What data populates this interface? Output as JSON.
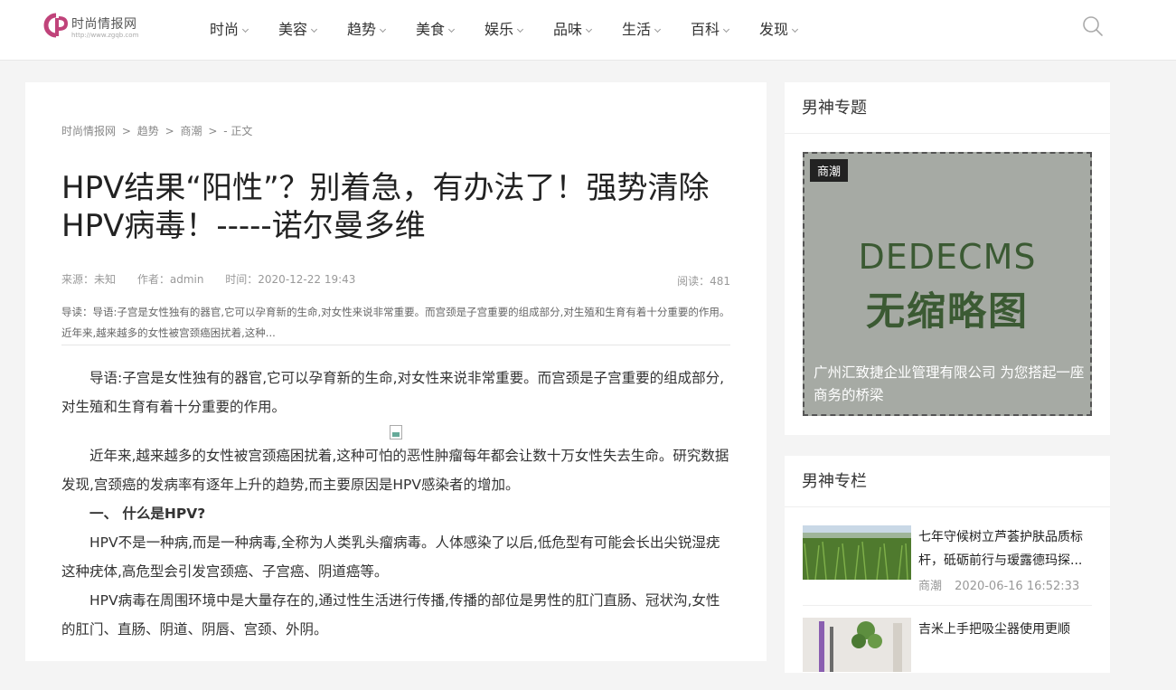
{
  "logo": {
    "name": "时尚情报网",
    "url": "http://www.zgqb.com"
  },
  "nav": [
    {
      "label": "时尚"
    },
    {
      "label": "美容"
    },
    {
      "label": "趋势"
    },
    {
      "label": "美食"
    },
    {
      "label": "娱乐"
    },
    {
      "label": "品味"
    },
    {
      "label": "生活"
    },
    {
      "label": "百科"
    },
    {
      "label": "发现"
    }
  ],
  "breadcrumb": {
    "home": "时尚情报网",
    "sep1": ">",
    "cat": "趋势",
    "sep2": ">",
    "sub": "商潮",
    "sep3": ">",
    "tail": "-  正文"
  },
  "article": {
    "title": "HPV结果“阳性”？别着急，有办法了！强势清除HPV病毒！-----诺尔曼多维",
    "source": "来源：未知",
    "author": "作者：admin",
    "time": "时间：2020-12-22 19:43",
    "reads": "阅读：481",
    "summary": "导读：导语:子宫是女性独有的器官,它可以孕育新的生命,对女性来说非常重要。而宫颈是子宫重要的组成部分,对生殖和生育有着十分重要的作用。 近年来,越来越多的女性被宫颈癌困扰着,这种...",
    "p1": "导语:子宫是女性独有的器官,它可以孕育新的生命,对女性来说非常重要。而宫颈是子宫重要的组成部分,对生殖和生育有着十分重要的作用。",
    "p2": "近年来,越来越多的女性被宫颈癌困扰着,这种可怕的恶性肿瘤每年都会让数十万女性失去生命。研究数据发现,宫颈癌的发病率有逐年上升的趋势,而主要原因是HPV感染者的增加。",
    "h1": "一、 什么是HPV?",
    "p3": "HPV不是一种病,而是一种病毒,全称为人类乳头瘤病毒。人体感染了以后,低危型有可能会长出尖锐湿疣这种疣体,高危型会引发宫颈癌、子宫癌、阴道癌等。",
    "p4": "HPV病毒在周围环境中是大量存在的,通过性生活进行传播,传播的部位是男性的肛门直肠、冠状沟,女性的肛门、直肠、阴道、阴唇、宫颈、外阴。"
  },
  "sidebar": {
    "topic_heading": "男神专题",
    "feature": {
      "tag": "商潮",
      "image_line1": "DEDECMS",
      "image_line2": "无缩略图",
      "caption": "广州汇致捷企业管理有限公司 为您搭起一座商务的桥梁"
    },
    "column_heading": "男神专栏",
    "items": [
      {
        "title": "七年守候树立芦荟护肤品质标杆，砥砺前行与瑷露德玛探...",
        "category": "商潮",
        "date": "2020-06-16 16:52:33"
      },
      {
        "title": "吉米上手把吸尘器使用更顺",
        "category": "",
        "date": ""
      }
    ]
  },
  "colors": {
    "accent": "#c0437a",
    "text": "#333333",
    "muted": "#999999"
  }
}
